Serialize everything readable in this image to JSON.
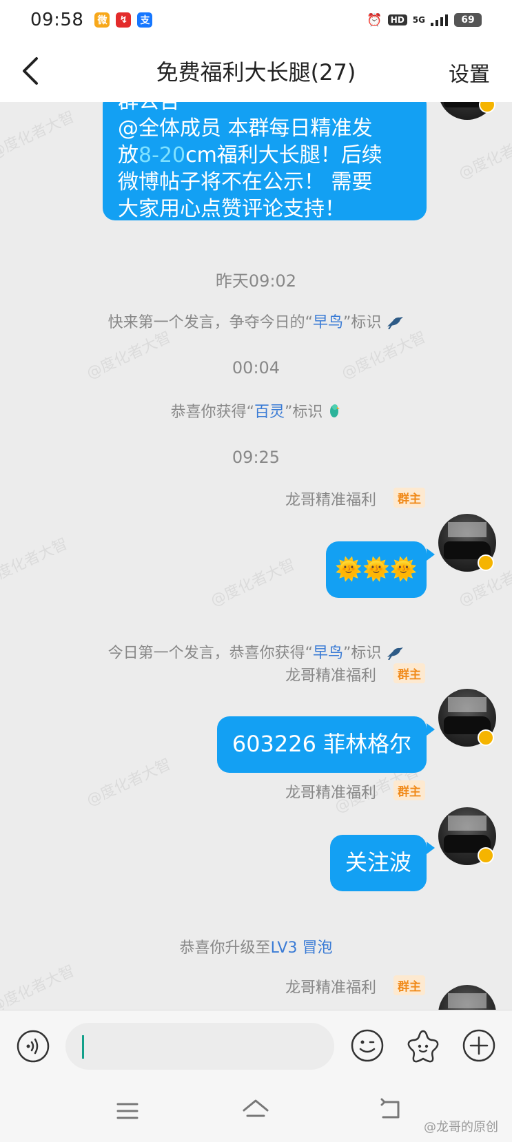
{
  "status_bar": {
    "time": "09:58",
    "apps": [
      {
        "name": "weibo-app-icon",
        "glyph": "微",
        "color": "#f7a81b"
      },
      {
        "name": "red-app-icon",
        "glyph": "↯",
        "color": "#e32b2b"
      },
      {
        "name": "alipay-app-icon",
        "glyph": "支",
        "color": "#1677ff"
      }
    ],
    "hd": "HD",
    "network": "5G",
    "battery": "69"
  },
  "header": {
    "title": "免费福利大长腿(27)",
    "settings_label": "设置"
  },
  "notice": {
    "lines": [
      [
        "群公告"
      ],
      [
        "@全体成员 本群每日精准发"
      ],
      [
        "放",
        "8-20",
        "cm福利大长腿！后续"
      ],
      [
        "微博帖子将不在公示！ 需要"
      ],
      [
        "大家用心点赞评论支持！"
      ]
    ]
  },
  "timeline": {
    "time_1": "昨天09:02",
    "early_bird_prompt": {
      "before": "快来第一个发言，争夺今日的“",
      "highlight": "早鸟",
      "after": "”标识"
    },
    "time_2": "00:04",
    "bailing_badge": {
      "before": "恭喜你获得“",
      "highlight": "百灵",
      "after": "”标识"
    },
    "time_3": "09:25",
    "early_bird_awarded": {
      "before": "今日第一个发言，恭喜你获得“",
      "highlight": "早鸟",
      "after": "”标识"
    },
    "level_up": {
      "before": "恭喜你升级至",
      "highlight": "LV3 冒泡"
    }
  },
  "sender": {
    "name": "龙哥精准福利",
    "role_badge": "群主"
  },
  "messages": [
    {
      "text": "🌞🌞🌞"
    },
    {
      "text": "603226 菲林格尔"
    },
    {
      "text": "关注波"
    }
  ],
  "watermark_text": "@度化者大智",
  "footer_watermark": "@龙哥的原创",
  "colors": {
    "bubble": "#13a0f3",
    "highlight_blue": "#3a7bd5",
    "owner_badge": "#f08a1a"
  }
}
